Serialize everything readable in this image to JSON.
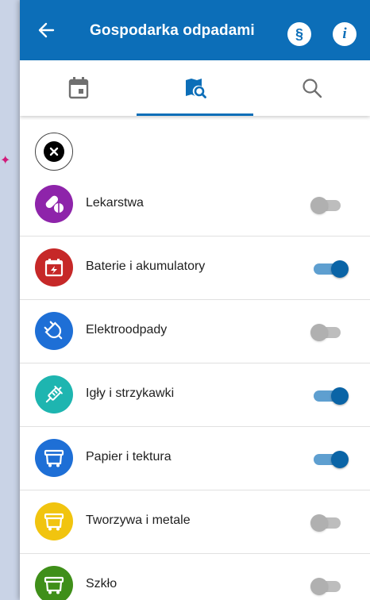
{
  "appbar": {
    "title": "Gospodarka odpadami",
    "para_symbol": "§",
    "info_symbol": "i"
  },
  "tabs": [
    {
      "icon": "calendar-icon",
      "active": false
    },
    {
      "icon": "map-search-icon",
      "active": true
    },
    {
      "icon": "search-icon",
      "active": false
    }
  ],
  "colors": {
    "primary": "#0c6eb8",
    "switch_on": "#0a64a6"
  },
  "items": [
    {
      "label": "Lekarstwa",
      "icon": "pills-icon",
      "color": "#8e24aa",
      "enabled": false
    },
    {
      "label": "Baterie i akumulatory",
      "icon": "battery-icon",
      "color": "#c62828",
      "enabled": true
    },
    {
      "label": "Elektroodpady",
      "icon": "plug-icon",
      "color": "#1e6fd6",
      "enabled": false
    },
    {
      "label": "Igły i strzykawki",
      "icon": "syringe-icon",
      "color": "#1eb5b0",
      "enabled": true
    },
    {
      "label": "Papier i tektura",
      "icon": "bin-icon",
      "color": "#1e6fd6",
      "enabled": true
    },
    {
      "label": "Tworzywa i metale",
      "icon": "bin-icon",
      "color": "#f1c40f",
      "enabled": false
    },
    {
      "label": "Szkło",
      "icon": "bin-icon",
      "color": "#3f8f19",
      "enabled": false
    }
  ]
}
